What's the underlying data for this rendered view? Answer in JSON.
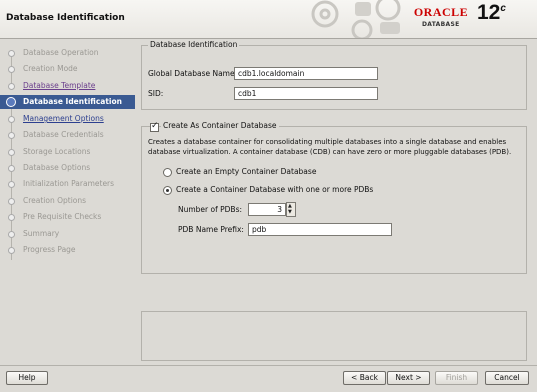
{
  "header": {
    "title": "Database Identification",
    "logo": {
      "brand": "ORACLE",
      "product": "DATABASE",
      "version": "12",
      "version_suffix": "c"
    }
  },
  "steps": [
    {
      "label": "Database Operation",
      "state": "done"
    },
    {
      "label": "Creation Mode",
      "state": "done"
    },
    {
      "label": "Database Template",
      "state": "link"
    },
    {
      "label": "Database Identification",
      "state": "current"
    },
    {
      "label": "Management Options",
      "state": "nav"
    },
    {
      "label": "Database Credentials",
      "state": "disabled"
    },
    {
      "label": "Storage Locations",
      "state": "disabled"
    },
    {
      "label": "Database Options",
      "state": "disabled"
    },
    {
      "label": "Initialization Parameters",
      "state": "disabled"
    },
    {
      "label": "Creation Options",
      "state": "disabled"
    },
    {
      "label": "Pre Requisite Checks",
      "state": "disabled"
    },
    {
      "label": "Summary",
      "state": "disabled"
    },
    {
      "label": "Progress Page",
      "state": "disabled"
    }
  ],
  "identification": {
    "legend": "Database Identification",
    "global_name_label": "Global Database Name:",
    "global_name_value": "cdb1.localdomain",
    "sid_label": "SID:",
    "sid_value": "cdb1"
  },
  "container": {
    "checkbox_label": "Create As Container Database",
    "checked": true,
    "description": "Creates a database container for consolidating multiple databases into a single database and enables database virtualization. A container database (CDB) can have zero or more pluggable databases (PDB).",
    "empty_option": "Create an Empty Container Database",
    "pdb_option": "Create a Container Database with one or more PDBs",
    "selected_option": "pdb",
    "num_pdbs_label": "Number of PDBs:",
    "num_pdbs_value": "3",
    "pdb_prefix_label": "PDB Name Prefix:",
    "pdb_prefix_value": "pdb"
  },
  "buttons": {
    "help": "Help",
    "back": "< Back",
    "next": "Next >",
    "finish": "Finish",
    "cancel": "Cancel"
  },
  "colors": {
    "current_step": "#3a5a92",
    "oracle_red": "#cc0000"
  }
}
